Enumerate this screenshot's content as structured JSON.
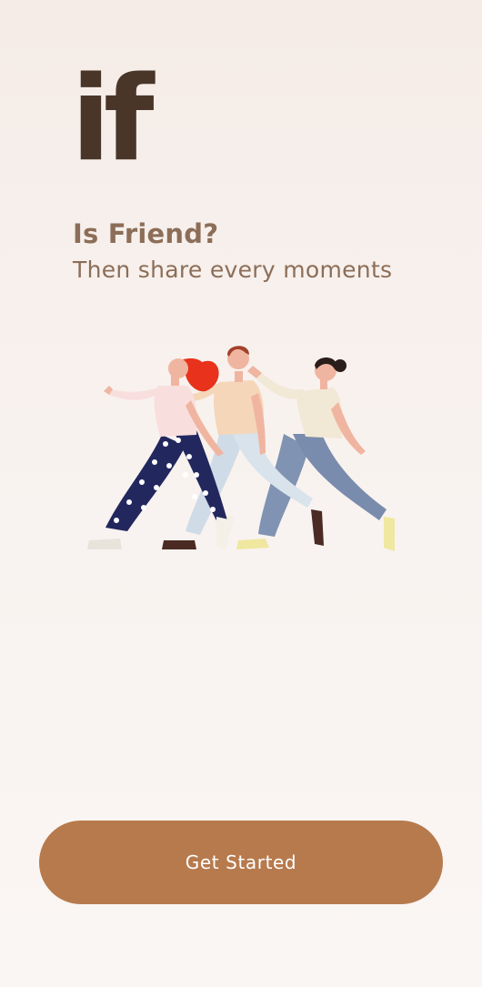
{
  "app": {
    "logo_text": "if"
  },
  "intro": {
    "headline": "Is Friend?",
    "tagline": "Then share every moments"
  },
  "illustration": {
    "description_icon": "three-friends-walking-illustration"
  },
  "cta": {
    "label": "Get Started"
  },
  "colors": {
    "brand_dark": "#4a3628",
    "text_brown": "#8c6e58",
    "button": "#b77a4d",
    "background": "#f8f2ef"
  }
}
